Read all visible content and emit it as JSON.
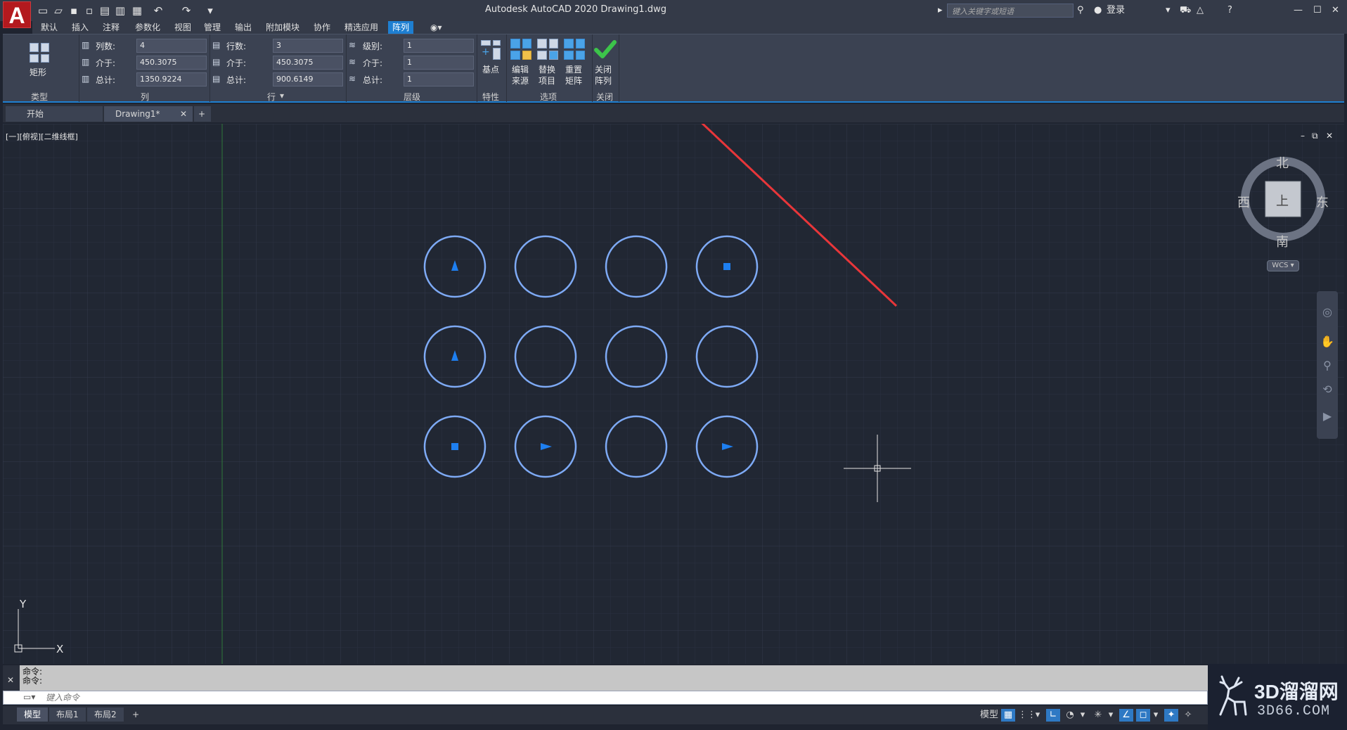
{
  "app": {
    "logo_letter": "A",
    "title": "Autodesk AutoCAD 2020    Drawing1.dwg",
    "search_placeholder": "键入关键字或短语",
    "login_label": "登录"
  },
  "menu_tabs": [
    {
      "label": "默认"
    },
    {
      "label": "插入"
    },
    {
      "label": "注释"
    },
    {
      "label": "参数化"
    },
    {
      "label": "视图"
    },
    {
      "label": "管理"
    },
    {
      "label": "输出"
    },
    {
      "label": "附加模块"
    },
    {
      "label": "协作"
    },
    {
      "label": "精选应用"
    },
    {
      "label": "阵列",
      "active": true
    }
  ],
  "ribbon": {
    "type_panel": {
      "button_label": "矩形",
      "title": "类型"
    },
    "columns_panel": {
      "title": "列",
      "rows": [
        {
          "label": "列数:",
          "value": "4"
        },
        {
          "label": "介于:",
          "value": "450.3075"
        },
        {
          "label": "总计:",
          "value": "1350.9224"
        }
      ]
    },
    "rows_panel": {
      "title": "行",
      "rows": [
        {
          "label": "行数:",
          "value": "3"
        },
        {
          "label": "介于:",
          "value": "450.3075"
        },
        {
          "label": "总计:",
          "value": "900.6149"
        }
      ]
    },
    "levels_panel": {
      "title": "层级",
      "rows": [
        {
          "label": "级别:",
          "value": "1"
        },
        {
          "label": "介于:",
          "value": "1"
        },
        {
          "label": "总计:",
          "value": "1"
        }
      ]
    },
    "properties_panel": {
      "title": "特性",
      "base_point_label": "基点"
    },
    "options_panel": {
      "title": "选项",
      "edit_source": "编辑\n来源",
      "replace_item": "替换\n项目",
      "reset_matrix": "重置\n矩阵"
    },
    "close_panel": {
      "title": "关闭",
      "close_label": "关闭\n阵列"
    }
  },
  "file_tabs": [
    {
      "label": "开始"
    },
    {
      "label": "Drawing1*",
      "active": true
    }
  ],
  "viewport": {
    "label": "[一][俯视][二维线框]",
    "compass": {
      "north": "北",
      "south": "南",
      "east": "东",
      "west": "西",
      "top_face": "上"
    },
    "wcs": "WCS",
    "ucs_x": "X",
    "ucs_y": "Y"
  },
  "array_grid": {
    "rows": 3,
    "columns": 4,
    "markers": [
      [
        "triangle-up",
        "none",
        "none",
        "square"
      ],
      [
        "triangle-up",
        "none",
        "none",
        "none"
      ],
      [
        "square",
        "triangle-right",
        "none",
        "triangle-right"
      ]
    ],
    "circle_color": "#7eaaf5",
    "marker_color": "#1e7ff0"
  },
  "command": {
    "history": [
      "命令:",
      "命令:"
    ],
    "input_placeholder": "键入命令"
  },
  "status_bar": {
    "layout_tabs": [
      {
        "label": "模型",
        "active": true
      },
      {
        "label": "布局1"
      },
      {
        "label": "布局2"
      }
    ],
    "model_label": "模型"
  },
  "watermark": {
    "brand": "3D溜溜网",
    "url": "3D66.COM"
  },
  "colors": {
    "accent": "#1e7fd1",
    "annotation_arrow": "#e8363a",
    "confirm_check": "#3cc44a"
  }
}
